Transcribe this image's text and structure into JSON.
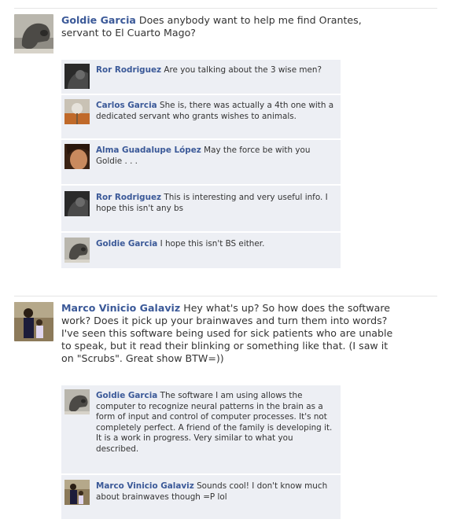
{
  "thread1": {
    "post": {
      "author": "Goldie Garcia",
      "text": "Does anybody want to help me find Orantes, servant to El Cuarto Mago?",
      "avatar_icon": "dog-avatar"
    },
    "comments": [
      {
        "author": "Ror Rodriguez",
        "text": "Are you talking about the 3 wise men?",
        "avatar_icon": "dark-photo-avatar"
      },
      {
        "author": "Carlos Garcia",
        "text": "She is, there was actually a 4th one with a dedicated servant who grants wishes to animals.",
        "avatar_icon": "dandelion-avatar"
      },
      {
        "author": "Alma Guadalupe López",
        "text": "May the force be with you Goldie . . .",
        "avatar_icon": "face-avatar"
      },
      {
        "author": "Ror Rodriguez",
        "text": "This is interesting and very useful info. I hope this isn't any bs",
        "avatar_icon": "dark-photo-avatar"
      },
      {
        "author": "Goldie Garcia",
        "text": "I hope this isn't BS either.",
        "avatar_icon": "dog-avatar"
      }
    ]
  },
  "thread2": {
    "post": {
      "author": "Marco Vinicio Galaviz",
      "text": "Hey what's up? So how does the software work? Does it pick up your brainwaves and turn them into words? I've seen this software being used for sick patients who are unable to speak, but it read their blinking or something like that. (I saw it on \"Scrubs\". Great show BTW=))",
      "avatar_icon": "person-photo-avatar"
    },
    "comments": [
      {
        "author": "Goldie Garcia",
        "text": "The software I am using allows the computer to recognize neural patterns in the brain as a form of input and control of computer processes. It's not completely perfect. A friend of the family is developing it. It is a work in progress. Very similar to what you described.",
        "avatar_icon": "dog-avatar"
      },
      {
        "author": "Marco Vinicio Galaviz",
        "text": "Sounds cool! I don't know much about brainwaves though =P lol",
        "avatar_icon": "person-photo-avatar"
      }
    ]
  }
}
